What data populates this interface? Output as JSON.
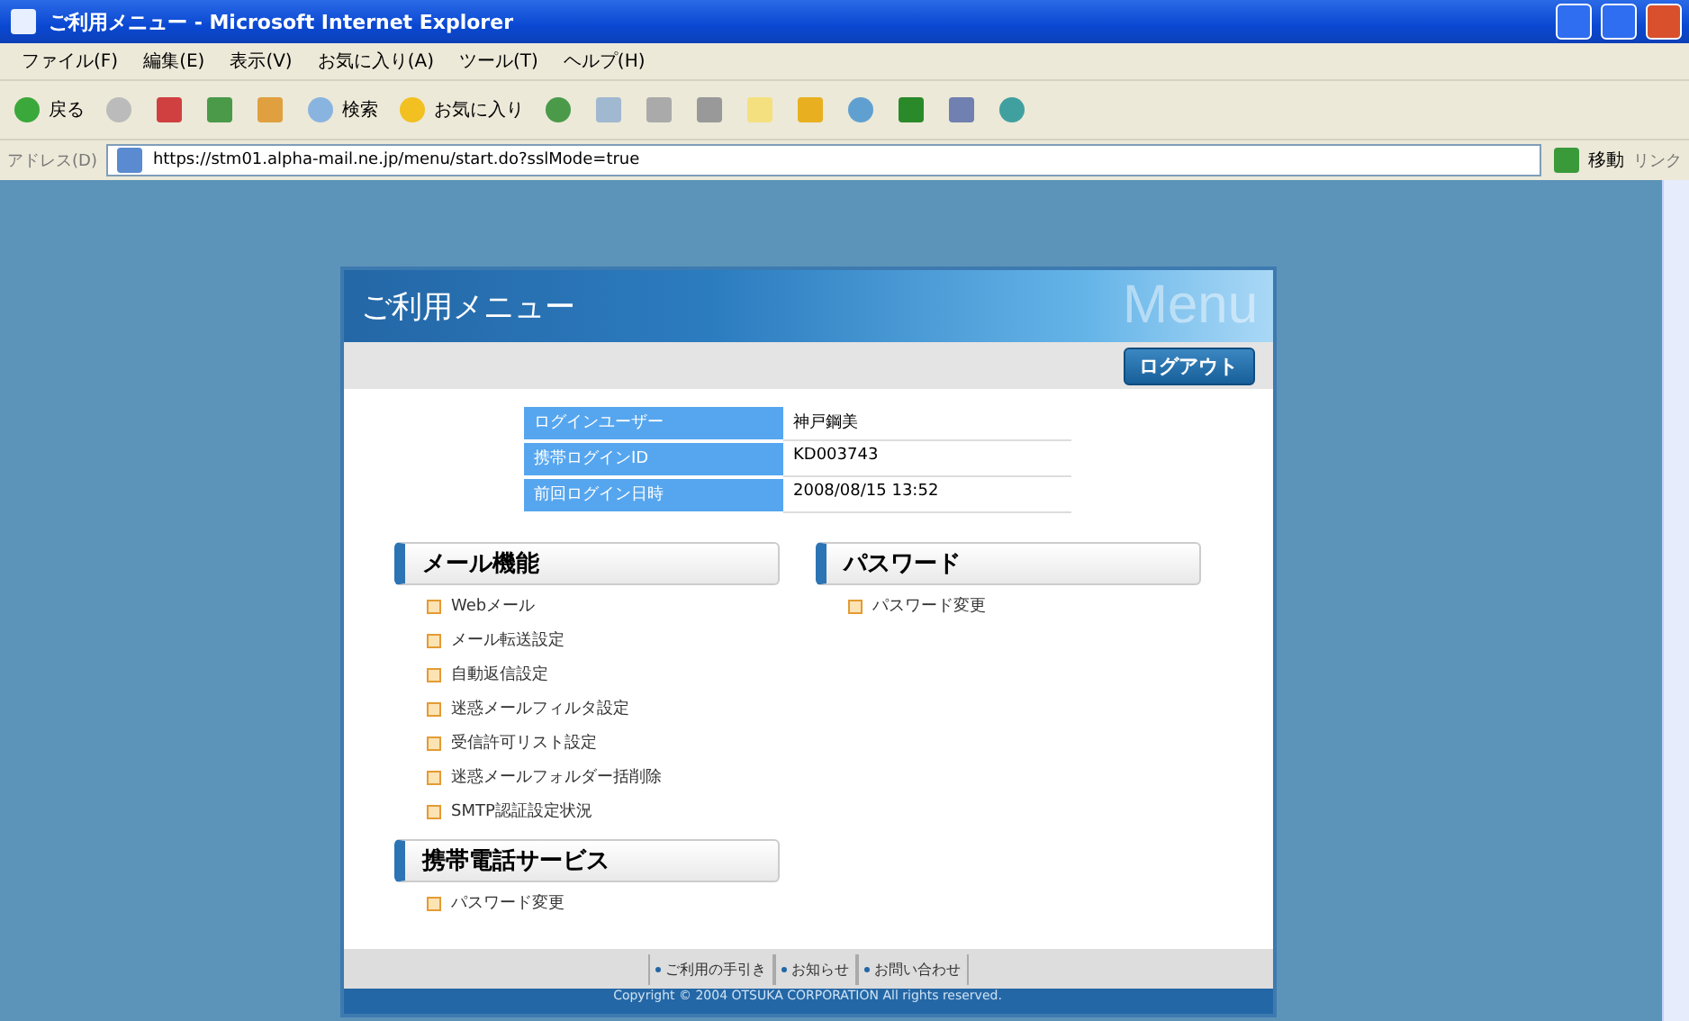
{
  "window": {
    "title": "ご利用メニュー - Microsoft Internet Explorer"
  },
  "menu_bar": [
    "ファイル(F)",
    "編集(E)",
    "表示(V)",
    "お気に入り(A)",
    "ツール(T)",
    "ヘルプ(H)"
  ],
  "toolbar": {
    "back": "戻る",
    "search": "検索",
    "favorites": "お気に入り"
  },
  "address_bar": {
    "label": "アドレス(D)",
    "value": "https://stm01.alpha-mail.ne.jp/menu/start.do?sslMode=true",
    "go": "移動",
    "links": "リンク"
  },
  "page": {
    "title": "ご利用メニュー",
    "title_decoration": "Menu",
    "logout": "ログアウト",
    "info": [
      {
        "label": "ログインユーザー",
        "value": "神戸鋼美"
      },
      {
        "label": "携帯ログインID",
        "value": "KD003743"
      },
      {
        "label": "前回ログイン日時",
        "value": "2008/08/15 13:52"
      }
    ],
    "columns": [
      {
        "sections": [
          {
            "title": "メール機能",
            "items": [
              "Webメール",
              "メール転送設定",
              "自動返信設定",
              "迷惑メールフィルタ設定",
              "受信許可リスト設定",
              "迷惑メールフォルダー括削除",
              "SMTP認証設定状況"
            ]
          },
          {
            "title": "携帯電話サービス",
            "items": [
              "パスワード変更"
            ]
          }
        ]
      },
      {
        "sections": [
          {
            "title": "パスワード",
            "items": [
              "パスワード変更"
            ]
          }
        ]
      }
    ],
    "footer_links": [
      "ご利用の手引き",
      "お知らせ",
      "お問い合わせ"
    ],
    "copyright": "Copyright © 2004 OTSUKA CORPORATION All rights reserved."
  }
}
